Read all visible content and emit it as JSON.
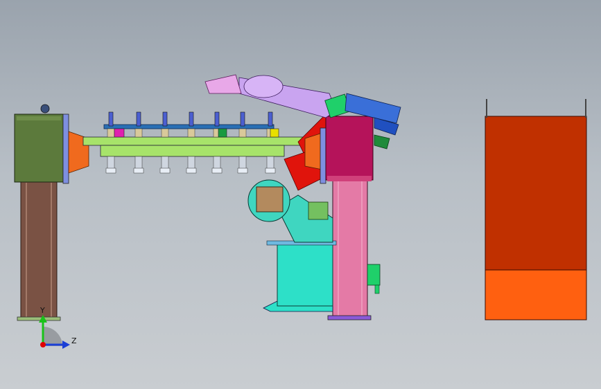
{
  "triad": {
    "y_label": "Y",
    "z_label": "Z",
    "y_color": "#19c219",
    "z_color": "#1b3fd6",
    "origin_color": "#e00000"
  },
  "colors": {
    "left_column_body": "#7a5244",
    "left_housing": "#5c7a3c",
    "fixture_plate": "#a7e36a",
    "clamp_rail": "#2a6fb4",
    "flange_orange": "#f06a1e",
    "bracket_red": "#e0140c",
    "right_column_body": "#e47aa6",
    "right_housing": "#b5135a",
    "robot_base": "#2de0c8",
    "robot_arm": "#3fd6c0",
    "wrist_purple": "#c9a4f0",
    "cable_blue": "#3a6fd8",
    "cable_green": "#1f8a3a",
    "gun_pink": "#e8a8e8",
    "fence_dark": "#c03000",
    "fence_light": "#ff6010"
  }
}
